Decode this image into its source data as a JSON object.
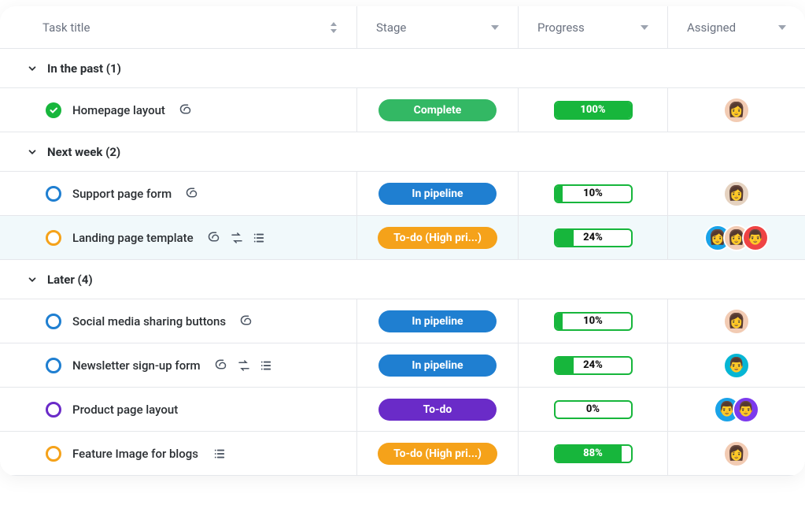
{
  "columns": {
    "task_title": "Task title",
    "stage": "Stage",
    "progress": "Progress",
    "assigned": "Assigned"
  },
  "groups": [
    {
      "label": "In the past (1)",
      "tasks": [
        {
          "title": "Homepage layout",
          "status": "complete",
          "status_color": "#17b63c",
          "icons": [
            "attachment"
          ],
          "stage_label": "Complete",
          "stage_class": "pill-complete",
          "progress": 100,
          "progress_label": "100%",
          "highlight": false,
          "avatars": [
            {
              "bg": "av-warm",
              "emoji": "👩"
            }
          ]
        }
      ]
    },
    {
      "label": "Next week (2)",
      "tasks": [
        {
          "title": "Support page form",
          "status": "open",
          "status_color": "#1f7fd1",
          "icons": [
            "attachment"
          ],
          "stage_label": "In pipeline",
          "stage_class": "pill-pipeline",
          "progress": 10,
          "progress_label": "10%",
          "highlight": false,
          "avatars": [
            {
              "bg": "av-sand",
              "emoji": "👩"
            }
          ]
        },
        {
          "title": "Landing page template",
          "status": "open",
          "status_color": "#f5a21a",
          "icons": [
            "attachment",
            "recurring",
            "subtasks"
          ],
          "stage_label": "To-do (High pri...)",
          "stage_class": "pill-todo-high",
          "progress": 24,
          "progress_label": "24%",
          "highlight": true,
          "avatars": [
            {
              "bg": "av-blue",
              "emoji": "👩"
            },
            {
              "bg": "av-warm",
              "emoji": "👩"
            },
            {
              "bg": "av-red",
              "emoji": "👨"
            }
          ]
        }
      ]
    },
    {
      "label": "Later (4)",
      "tasks": [
        {
          "title": "Social media sharing buttons",
          "status": "open",
          "status_color": "#1f7fd1",
          "icons": [
            "attachment"
          ],
          "stage_label": "In pipeline",
          "stage_class": "pill-pipeline",
          "progress": 10,
          "progress_label": "10%",
          "highlight": false,
          "avatars": [
            {
              "bg": "av-warm",
              "emoji": "👩"
            }
          ]
        },
        {
          "title": "Newsletter sign-up form",
          "status": "open",
          "status_color": "#1f7fd1",
          "icons": [
            "attachment",
            "recurring",
            "subtasks"
          ],
          "stage_label": "In pipeline",
          "stage_class": "pill-pipeline",
          "progress": 24,
          "progress_label": "24%",
          "highlight": false,
          "avatars": [
            {
              "bg": "av-teal",
              "emoji": "👨"
            }
          ]
        },
        {
          "title": "Product page layout",
          "status": "open",
          "status_color": "#6a2bc8",
          "icons": [],
          "stage_label": "To-do",
          "stage_class": "pill-todo",
          "progress": 0,
          "progress_label": "0%",
          "highlight": false,
          "avatars": [
            {
              "bg": "av-blue",
              "emoji": "👨"
            },
            {
              "bg": "av-purple",
              "emoji": "👨"
            }
          ]
        },
        {
          "title": "Feature Image for blogs",
          "status": "open",
          "status_color": "#f5a21a",
          "icons": [
            "subtasks"
          ],
          "stage_label": "To-do (High pri...)",
          "stage_class": "pill-todo-high",
          "progress": 88,
          "progress_label": "88%",
          "highlight": false,
          "avatars": [
            {
              "bg": "av-warm",
              "emoji": "👩"
            }
          ]
        }
      ]
    }
  ]
}
